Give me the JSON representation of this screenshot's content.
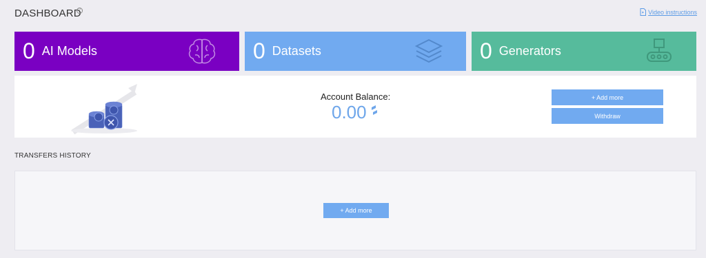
{
  "header": {
    "title": "DASHBOARD",
    "help_icon": "help-circle-icon",
    "help_glyph": "?",
    "video_link": "Video instructions",
    "video_icon": "video-file-icon"
  },
  "cards": [
    {
      "count": "0",
      "label": "AI Models",
      "color": "#7a00c2",
      "icon": "brain-icon"
    },
    {
      "count": "0",
      "label": "Datasets",
      "color": "#71aaf0",
      "icon": "layers-icon"
    },
    {
      "count": "0",
      "label": "Generators",
      "color": "#56bb9c",
      "icon": "conveyor-icon"
    }
  ],
  "balance": {
    "label": "Account Balance:",
    "value": "0.00",
    "currency_icon": "token-icon",
    "add_label": "+ Add more",
    "withdraw_label": "Withdraw",
    "illustration": "coin-stacks-illustration"
  },
  "transfers": {
    "title": "TRANSFERS HISTORY",
    "add_label": "+ Add more"
  },
  "colors": {
    "accent": "#71aaf0",
    "background": "#eeedf2",
    "panel": "#ffffff",
    "link": "#5b9be6"
  }
}
